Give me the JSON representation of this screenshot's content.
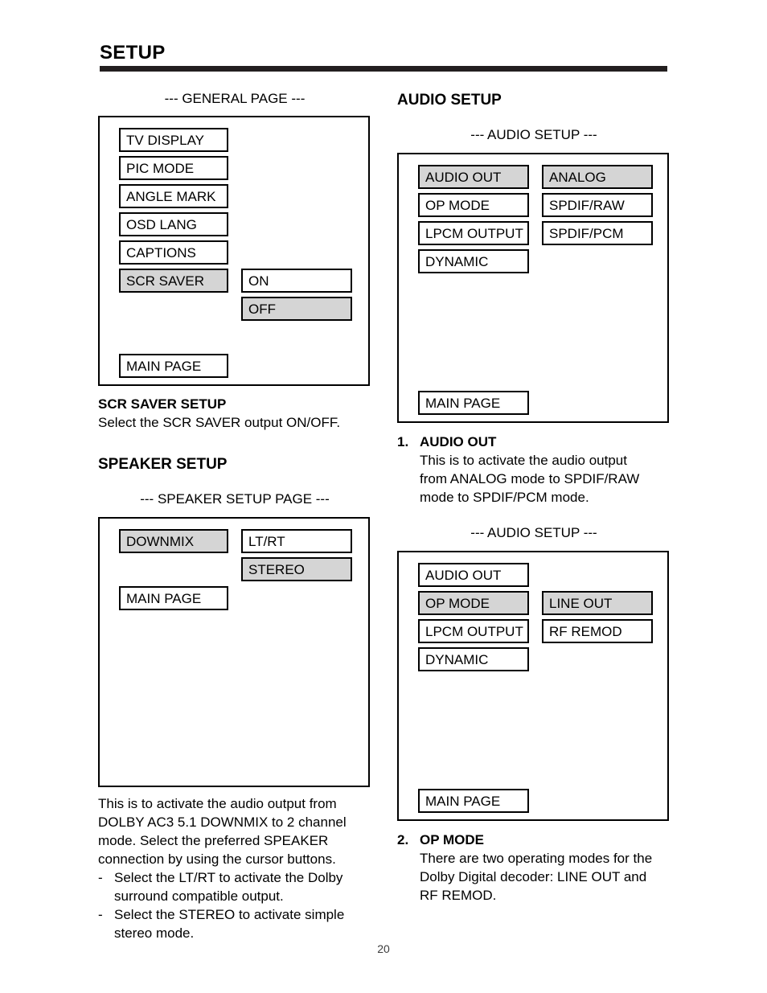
{
  "document": {
    "title": "SETUP",
    "page_number": "20"
  },
  "colors": {
    "highlight": "#d5d5d5",
    "rule": "#231f20",
    "border": "#000000"
  },
  "left_column": {
    "general_page": {
      "caption": "--- GENERAL PAGE ---",
      "menu_items": [
        {
          "label": "TV DISPLAY",
          "highlighted": false
        },
        {
          "label": "PIC MODE",
          "highlighted": false
        },
        {
          "label": "ANGLE MARK",
          "highlighted": false
        },
        {
          "label": "OSD LANG",
          "highlighted": false
        },
        {
          "label": "CAPTIONS",
          "highlighted": false
        },
        {
          "label": "SCR SAVER",
          "highlighted": true
        }
      ],
      "submenu_items": [
        {
          "label": "ON",
          "highlighted": false
        },
        {
          "label": "OFF",
          "highlighted": true
        }
      ],
      "main_page_label": "MAIN PAGE"
    },
    "scr_saver_setup": {
      "heading": "SCR SAVER SETUP",
      "body": "Select the SCR SAVER output ON/OFF."
    },
    "speaker_setup": {
      "heading": "SPEAKER SETUP",
      "caption": "--- SPEAKER SETUP PAGE ---",
      "menu_items": [
        {
          "label": "DOWNMIX",
          "highlighted": true
        }
      ],
      "submenu_items": [
        {
          "label": "LT/RT",
          "highlighted": false
        },
        {
          "label": "STEREO",
          "highlighted": true
        }
      ],
      "main_page_label": "MAIN PAGE",
      "body_lines": [
        "This is to activate the audio output from",
        "DOLBY AC3 5.1 DOWNMIX to 2 channel",
        "mode.  Select the preferred SPEAKER",
        "connection by using the cursor buttons."
      ],
      "bullets": [
        {
          "marker": "-",
          "text": "Select the LT/RT to activate the Dolby surround compatible output."
        },
        {
          "marker": "-",
          "text": "Select the STEREO to activate simple stereo mode."
        }
      ]
    }
  },
  "right_column": {
    "audio_setup": {
      "heading": "AUDIO SETUP",
      "caption_1": "--- AUDIO SETUP ---",
      "panel_1": {
        "menu_items": [
          {
            "label": "AUDIO OUT",
            "highlighted": true
          },
          {
            "label": "OP MODE",
            "highlighted": false
          },
          {
            "label": "LPCM OUTPUT",
            "highlighted": false
          },
          {
            "label": "DYNAMIC",
            "highlighted": false
          }
        ],
        "submenu_items": [
          {
            "label": "ANALOG",
            "highlighted": true
          },
          {
            "label": "SPDIF/RAW",
            "highlighted": false
          },
          {
            "label": "SPDIF/PCM",
            "highlighted": false
          }
        ],
        "main_page_label": "MAIN PAGE"
      },
      "item_1": {
        "number": "1.",
        "title": "AUDIO OUT",
        "body_lines": [
          "This is to activate the audio output",
          "from ANALOG mode to SPDIF/RAW",
          "mode to SPDIF/PCM mode."
        ]
      },
      "caption_2": "--- AUDIO SETUP ---",
      "panel_2": {
        "menu_items": [
          {
            "label": "AUDIO OUT",
            "highlighted": false
          },
          {
            "label": "OP MODE",
            "highlighted": true
          },
          {
            "label": "LPCM OUTPUT",
            "highlighted": false
          },
          {
            "label": "DYNAMIC",
            "highlighted": false
          }
        ],
        "submenu_items": [
          {
            "label": "LINE OUT",
            "highlighted": true
          },
          {
            "label": "RF REMOD",
            "highlighted": false
          }
        ],
        "main_page_label": "MAIN PAGE"
      },
      "item_2": {
        "number": "2.",
        "title": "OP MODE",
        "body_lines": [
          "There are two operating modes for the",
          "Dolby Digital decoder:  LINE OUT and",
          "RF REMOD."
        ]
      }
    }
  }
}
